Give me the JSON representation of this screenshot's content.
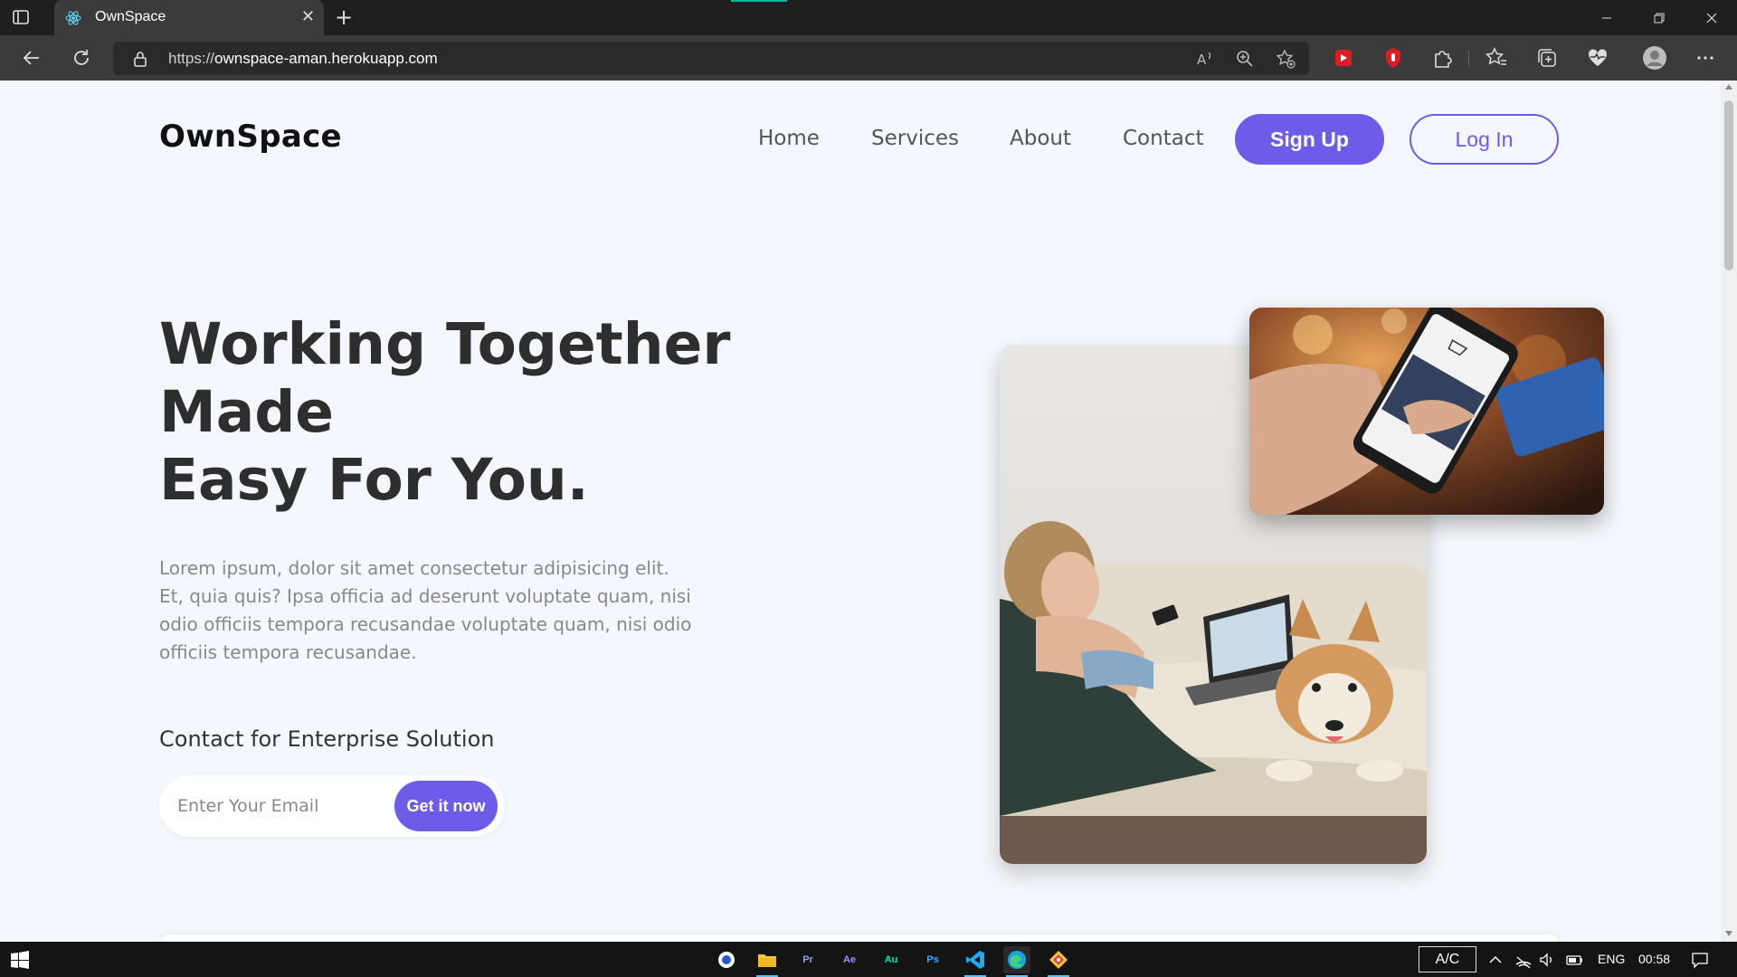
{
  "browser": {
    "tab_title": "OwnSpace",
    "url_scheme": "https://",
    "url_host": "ownspace-aman.herokuapp.com"
  },
  "nav": {
    "logo": "OwnSpace",
    "links": [
      "Home",
      "Services",
      "About",
      "Contact"
    ],
    "signup_label": "Sign Up",
    "login_label": "Log In"
  },
  "hero": {
    "title_lines": [
      "Working Together",
      "Made",
      "Easy For You."
    ],
    "description": "Lorem ipsum, dolor sit amet consectetur adipisicing elit. Et, quia quis? Ipsa officia ad deserunt voluptate quam, nisi odio officiis tempora recusandae voluptate quam, nisi odio officiis tempora recusandae.",
    "enterprise_label": "Contact for Enterprise Solution",
    "email_placeholder": "Enter Your Email",
    "cta_label": "Get it now"
  },
  "taskbar": {
    "apps": [
      "Pr",
      "Ae",
      "Au",
      "Ps"
    ],
    "ac_label": "A/C",
    "language": "ENG",
    "time": "00:58"
  },
  "colors": {
    "accent": "#6c5ce7",
    "page_bg": "#f4f7fd",
    "chrome_dark": "#1f1f1f",
    "chrome_toolbar": "#3b3b3b"
  }
}
